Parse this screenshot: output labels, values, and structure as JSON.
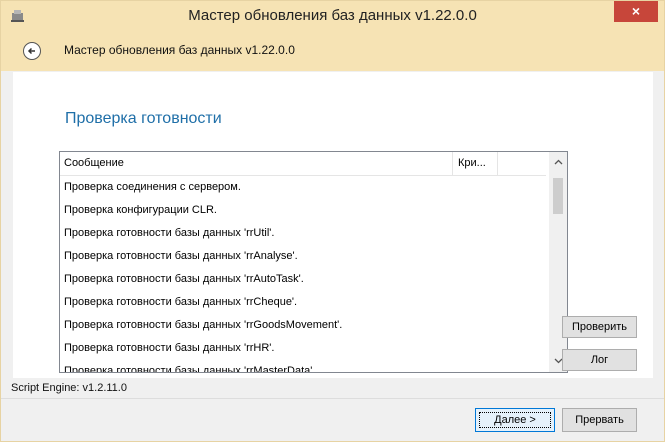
{
  "window": {
    "title": "Мастер обновления баз данных v1.22.0.0",
    "close_glyph": "×"
  },
  "nav": {
    "title": "Мастер обновления баз данных v1.22.0.0"
  },
  "page": {
    "heading": "Проверка готовности"
  },
  "list": {
    "columns": [
      "Сообщение",
      "Кри..."
    ],
    "rows": [
      "Проверка соединения с сервером.",
      "Проверка конфигурации CLR.",
      "Проверка готовности базы данных 'rrUtil'.",
      "Проверка готовности базы данных 'rrAnalyse'.",
      "Проверка готовности базы данных 'rrAutoTask'.",
      "Проверка готовности базы данных 'rrCheque'.",
      "Проверка готовности базы данных 'rrGoodsMovement'.",
      "Проверка готовности базы данных 'rrHR'.",
      "Проверка готовности базы данных 'rrMasterData'."
    ]
  },
  "side_buttons": {
    "check": "Проверить",
    "log": "Лог"
  },
  "footer": {
    "engine": "Script Engine: v1.2.11.0",
    "next": "Далее >",
    "cancel": "Прервать"
  },
  "colors": {
    "titlebar": "#f6e3b4",
    "close": "#c7463a",
    "heading": "#1f6fa8"
  }
}
